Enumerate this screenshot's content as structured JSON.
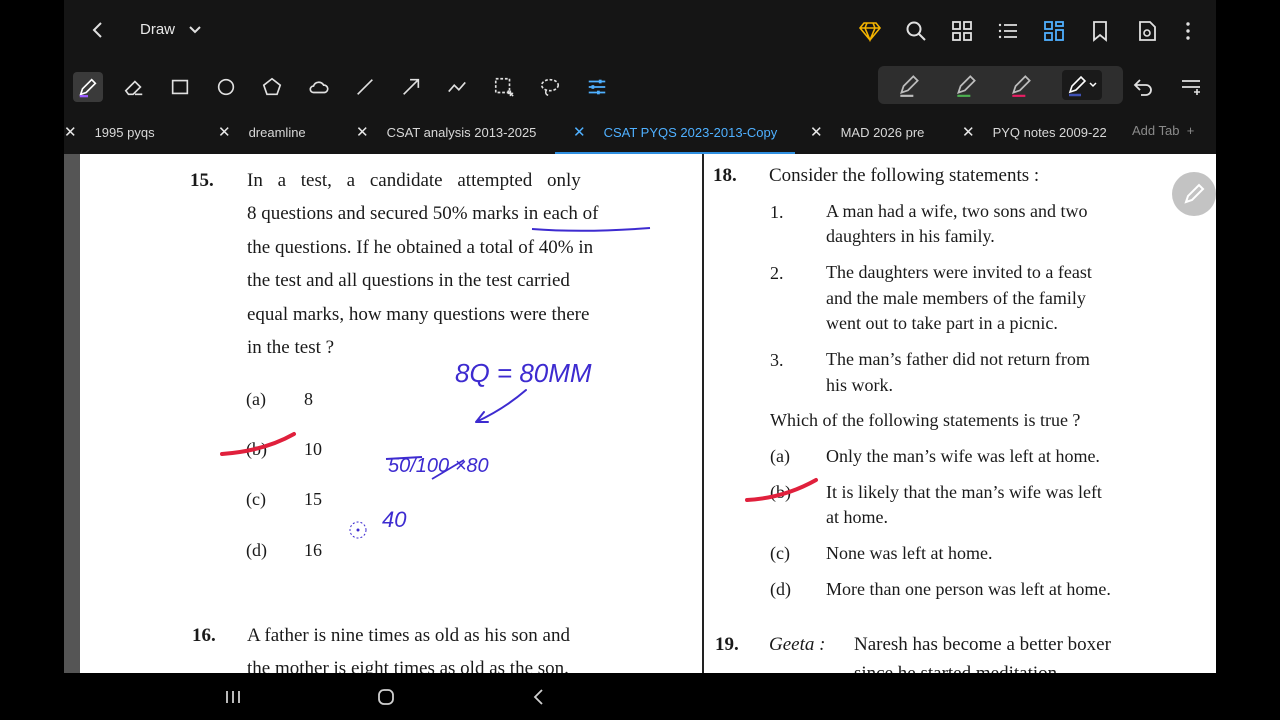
{
  "app": {
    "title": "Draw",
    "back_icon": "back-arrow-icon",
    "dropdown_icon": "chevron-down-icon"
  },
  "top_icons": [
    "premium-diamond-icon",
    "search-icon",
    "grid-view-icon",
    "list-icon",
    "layout-icon",
    "bookmark-icon",
    "document-settings-icon",
    "more-vert-icon"
  ],
  "tools": [
    "pen-tool-icon",
    "eraser-icon",
    "rectangle-icon",
    "circle-icon",
    "pentagon-icon",
    "cloud-icon",
    "line-icon",
    "arrow-icon",
    "curve-icon",
    "lasso-select-icon",
    "lasso-free-icon",
    "settings-sliders-icon"
  ],
  "pens": {
    "colors": [
      "#bdbdbd",
      "#4caf50",
      "#e91e63",
      "#3f51b5"
    ],
    "selected": 3
  },
  "tabs": [
    {
      "label": "1995 pyqs",
      "active": false
    },
    {
      "label": "dreamline",
      "active": false
    },
    {
      "label": "CSAT analysis 2013-2025",
      "active": false
    },
    {
      "label": "CSAT PYQS 2023-2013-Copy",
      "active": true
    },
    {
      "label": "MAD 2026 pre",
      "active": false
    },
    {
      "label": "PYQ notes 2009-22",
      "active": false
    }
  ],
  "add_tab": "Add Tab",
  "left": {
    "q15": {
      "num": "15.",
      "lines": [
        "In a test, a candidate attempted only",
        "8 questions and secured 50% marks in each of",
        "the questions. If he obtained a total of 40% in",
        "the test and all questions in the test carried",
        "equal marks, how many questions were there",
        "in the test ?"
      ],
      "options": [
        {
          "key": "(a)",
          "val": "8"
        },
        {
          "key": "(b)",
          "val": "10"
        },
        {
          "key": "(c)",
          "val": "15"
        },
        {
          "key": "(d)",
          "val": "16"
        }
      ]
    },
    "q16": {
      "num": "16.",
      "lines": [
        "A father is nine times as old as his son and",
        "the mother is eight times as old as the son."
      ]
    },
    "handwriting": {
      "eq": "8Q = 80MM",
      "calc": "50/100 ×80",
      "result": "40"
    }
  },
  "right": {
    "q18": {
      "num": "18.",
      "intro": "Consider the following statements :",
      "statements": [
        {
          "n": "1.",
          "lines": [
            "A man had a wife, two sons and two",
            "daughters in his family."
          ]
        },
        {
          "n": "2.",
          "lines": [
            "The daughters were invited to a feast",
            "and the male members of the family",
            "went out to take part in a picnic."
          ]
        },
        {
          "n": "3.",
          "lines": [
            "The man’s father did not return from",
            "his work."
          ]
        }
      ],
      "question": "Which of the following statements is true ?",
      "options": [
        {
          "key": "(a)",
          "lines": [
            "Only the man’s wife was left at home."
          ]
        },
        {
          "key": "(b)",
          "lines": [
            "It is likely that the man’s wife was left",
            "at home."
          ]
        },
        {
          "key": "(c)",
          "lines": [
            "None was left at home."
          ]
        },
        {
          "key": "(d)",
          "lines": [
            "More than one person was left at home."
          ]
        }
      ]
    },
    "q19": {
      "num": "19.",
      "speaker": "Geeta :",
      "line": "Naresh has become a better boxer",
      "line2": "since he started meditation."
    }
  },
  "nav": [
    "recents-icon",
    "home-icon",
    "back-icon"
  ]
}
